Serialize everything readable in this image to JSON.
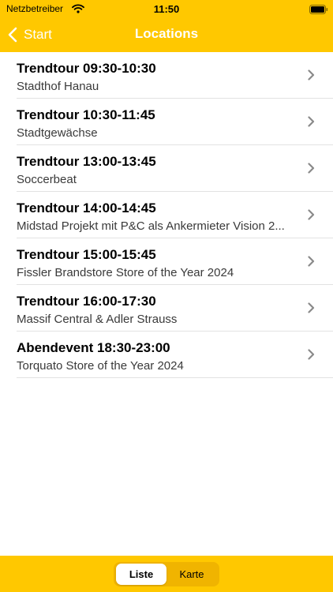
{
  "status_bar": {
    "carrier": "Netzbetreiber",
    "time": "11:50"
  },
  "nav": {
    "back_label": "Start",
    "title": "Locations"
  },
  "locations": [
    {
      "title": "Trendtour 09:30-10:30",
      "subtitle": "Stadthof Hanau"
    },
    {
      "title": "Trendtour 10:30-11:45",
      "subtitle": "Stadtgewächse"
    },
    {
      "title": "Trendtour 13:00-13:45",
      "subtitle": "Soccerbeat"
    },
    {
      "title": "Trendtour 14:00-14:45",
      "subtitle": "Midstad Projekt mit P&C als Ankermieter Vision 2..."
    },
    {
      "title": "Trendtour 15:00-15:45",
      "subtitle": "Fissler Brandstore Store of the Year 2024"
    },
    {
      "title": "Trendtour 16:00-17:30",
      "subtitle": "Massif Central & Adler Strauss"
    },
    {
      "title": "Abendevent 18:30-23:00",
      "subtitle": "Torquato Store of the Year 2024"
    }
  ],
  "segmented_control": {
    "options": [
      "Liste",
      "Karte"
    ],
    "selected": "Liste"
  },
  "colors": {
    "accent": "#FFC800",
    "chevron": "#8a8a8a"
  },
  "icons": [
    "wifi-icon",
    "battery-icon",
    "back-chevron-icon",
    "chevron-right-icon"
  ]
}
